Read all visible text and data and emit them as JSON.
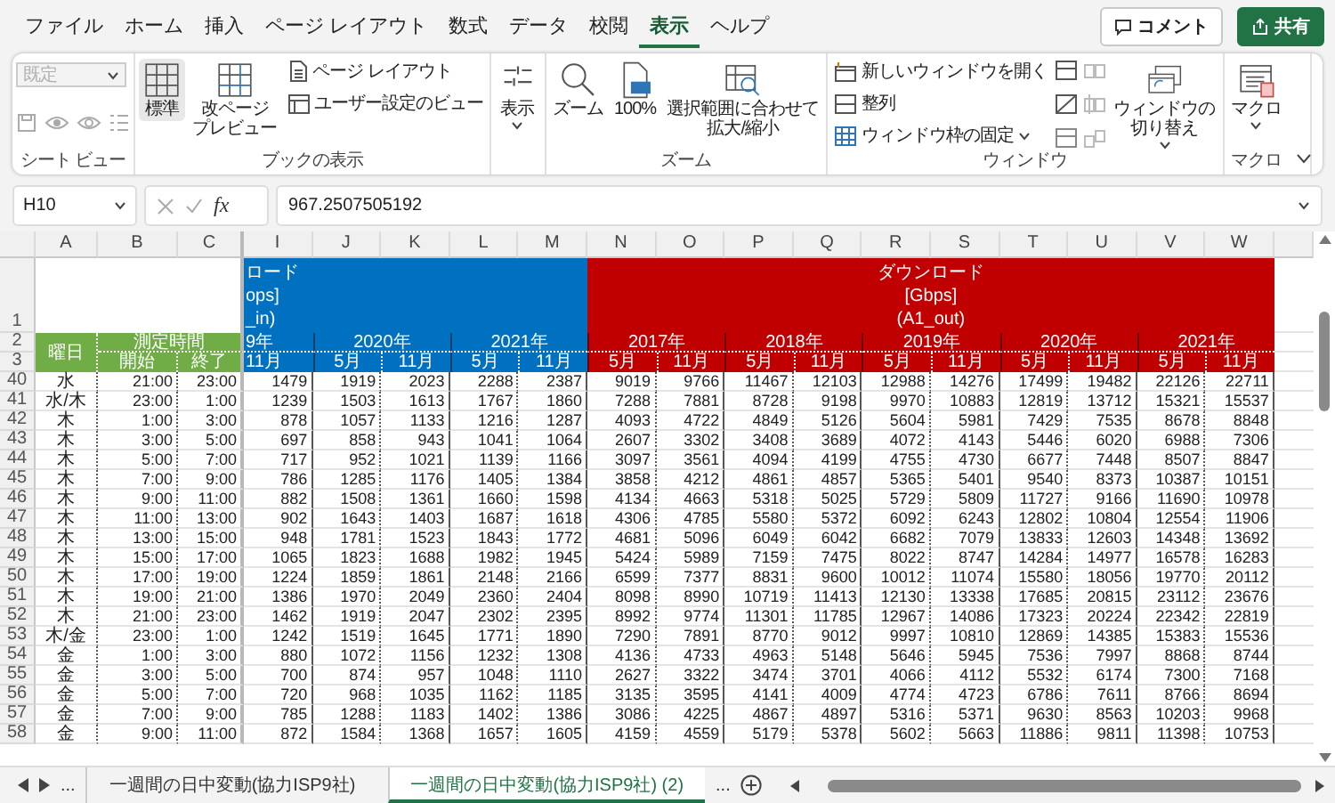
{
  "menu_tabs": [
    {
      "label": "ファイル",
      "selected": false
    },
    {
      "label": "ホーム",
      "selected": false
    },
    {
      "label": "挿入",
      "selected": false
    },
    {
      "label": "ページ レイアウト",
      "selected": false
    },
    {
      "label": "数式",
      "selected": false
    },
    {
      "label": "データ",
      "selected": false
    },
    {
      "label": "校閲",
      "selected": false
    },
    {
      "label": "表示",
      "selected": true
    },
    {
      "label": "ヘルプ",
      "selected": false
    }
  ],
  "top_buttons": [
    {
      "kind": "comment",
      "label": "コメント"
    },
    {
      "kind": "share",
      "label": "共有"
    }
  ],
  "ribbon": [
    {
      "label": "シート ビュー",
      "items": [
        {
          "kind": "dropdown",
          "label": "既定",
          "disabled": true
        }
      ]
    },
    {
      "label": "ブックの表示",
      "items": [
        {
          "kind": "large",
          "label": "標準",
          "selected": true
        },
        {
          "kind": "large",
          "lines": [
            "改ページ",
            "プレビュー"
          ],
          "selected": false
        },
        {
          "kind": "small",
          "label": "ページ レイアウト"
        },
        {
          "kind": "small",
          "label": "ユーザー設定のビュー"
        }
      ]
    },
    {
      "items": [
        {
          "kind": "large",
          "label": "表示",
          "dropdown": true
        }
      ]
    },
    {
      "label": "ズーム",
      "items": [
        {
          "kind": "large",
          "label": "ズーム"
        },
        {
          "kind": "large",
          "label": "100%"
        },
        {
          "kind": "large",
          "lines": [
            "選択範囲に合わせて",
            "拡大/縮小"
          ]
        }
      ]
    },
    {
      "label": "ウィンドウ",
      "items": [
        {
          "kind": "small",
          "label": "新しいウィンドウを開く"
        },
        {
          "kind": "small",
          "label": "整列"
        },
        {
          "kind": "small",
          "label": "ウィンドウ枠の固定",
          "dropdown": true
        },
        {
          "kind": "large",
          "lines": [
            "ウィンドウの",
            "切り替え"
          ],
          "dropdown": true
        }
      ]
    },
    {
      "label": "マクロ",
      "items": [
        {
          "kind": "large",
          "label": "マクロ",
          "dropdown": true
        }
      ]
    }
  ],
  "formula_bar": {
    "name_box": "H10",
    "function_label": "fx",
    "value": "967.2507505192"
  },
  "sheet": {
    "columns": [
      "A",
      "B",
      "C",
      "I",
      "J",
      "K",
      "L",
      "M",
      "N",
      "O",
      "P",
      "Q",
      "R",
      "S",
      "T",
      "U",
      "V",
      "W"
    ],
    "header_row_numbers": [
      "1",
      "2",
      "3"
    ],
    "upload_title_lines": [
      "ロード",
      "ops]",
      "_in)"
    ],
    "download_title_lines": [
      "ダウンロード",
      "[Gbps]",
      "(A1_out)"
    ],
    "day_label": "曜日",
    "time_label": "測定時間",
    "start_label": "開始",
    "end_label": "終了",
    "upload_years": [
      {
        "label": "9年",
        "months": [
          "11月"
        ]
      },
      {
        "label": "2020年",
        "months": [
          "5月",
          "11月"
        ]
      },
      {
        "label": "2021年",
        "months": [
          "5月",
          "11月"
        ]
      }
    ],
    "download_years": [
      {
        "label": "2017年",
        "months": [
          "5月",
          "11月"
        ]
      },
      {
        "label": "2018年",
        "months": [
          "5月",
          "11月"
        ]
      },
      {
        "label": "2019年",
        "months": [
          "5月",
          "11月"
        ]
      },
      {
        "label": "2020年",
        "months": [
          "5月",
          "11月"
        ]
      },
      {
        "label": "2021年",
        "months": [
          "5月",
          "11月"
        ]
      }
    ],
    "rows": [
      {
        "row": "40",
        "day": "水",
        "start": "21:00",
        "end": "23:00",
        "values": [
          "1479",
          "1919",
          "2023",
          "2288",
          "2387",
          "9019",
          "9766",
          "11467",
          "12103",
          "12988",
          "14276",
          "17499",
          "19482",
          "22126",
          "22711"
        ]
      },
      {
        "row": "41",
        "day": "水/木",
        "start": "23:00",
        "end": "1:00",
        "values": [
          "1239",
          "1503",
          "1613",
          "1767",
          "1860",
          "7288",
          "7881",
          "8728",
          "9198",
          "9970",
          "10883",
          "12819",
          "13712",
          "15321",
          "15537"
        ]
      },
      {
        "row": "42",
        "day": "木",
        "start": "1:00",
        "end": "3:00",
        "values": [
          "878",
          "1057",
          "1133",
          "1216",
          "1287",
          "4093",
          "4722",
          "4849",
          "5126",
          "5604",
          "5981",
          "7429",
          "7535",
          "8678",
          "8848"
        ]
      },
      {
        "row": "43",
        "day": "木",
        "start": "3:00",
        "end": "5:00",
        "values": [
          "697",
          "858",
          "943",
          "1041",
          "1064",
          "2607",
          "3302",
          "3408",
          "3689",
          "4072",
          "4143",
          "5446",
          "6020",
          "6988",
          "7306"
        ]
      },
      {
        "row": "44",
        "day": "木",
        "start": "5:00",
        "end": "7:00",
        "values": [
          "717",
          "952",
          "1021",
          "1139",
          "1166",
          "3097",
          "3561",
          "4094",
          "4199",
          "4755",
          "4730",
          "6677",
          "7448",
          "8507",
          "8847"
        ]
      },
      {
        "row": "45",
        "day": "木",
        "start": "7:00",
        "end": "9:00",
        "values": [
          "786",
          "1285",
          "1176",
          "1405",
          "1384",
          "3858",
          "4212",
          "4861",
          "4857",
          "5365",
          "5401",
          "9540",
          "8373",
          "10387",
          "10151"
        ]
      },
      {
        "row": "46",
        "day": "木",
        "start": "9:00",
        "end": "11:00",
        "values": [
          "882",
          "1508",
          "1361",
          "1660",
          "1598",
          "4134",
          "4663",
          "5318",
          "5025",
          "5729",
          "5809",
          "11727",
          "9166",
          "11690",
          "10978"
        ]
      },
      {
        "row": "47",
        "day": "木",
        "start": "11:00",
        "end": "13:00",
        "values": [
          "902",
          "1643",
          "1403",
          "1687",
          "1618",
          "4306",
          "4785",
          "5580",
          "5372",
          "6092",
          "6243",
          "12802",
          "10804",
          "12554",
          "11906"
        ]
      },
      {
        "row": "48",
        "day": "木",
        "start": "13:00",
        "end": "15:00",
        "values": [
          "948",
          "1781",
          "1523",
          "1843",
          "1772",
          "4681",
          "5096",
          "6049",
          "6042",
          "6682",
          "7079",
          "13833",
          "12603",
          "14348",
          "13692"
        ]
      },
      {
        "row": "49",
        "day": "木",
        "start": "15:00",
        "end": "17:00",
        "values": [
          "1065",
          "1823",
          "1688",
          "1982",
          "1945",
          "5424",
          "5989",
          "7159",
          "7475",
          "8022",
          "8747",
          "14284",
          "14977",
          "16578",
          "16283"
        ]
      },
      {
        "row": "50",
        "day": "木",
        "start": "17:00",
        "end": "19:00",
        "values": [
          "1224",
          "1859",
          "1861",
          "2148",
          "2166",
          "6599",
          "7377",
          "8831",
          "9600",
          "10012",
          "11074",
          "15580",
          "18056",
          "19770",
          "20112"
        ]
      },
      {
        "row": "51",
        "day": "木",
        "start": "19:00",
        "end": "21:00",
        "values": [
          "1386",
          "1970",
          "2049",
          "2360",
          "2404",
          "8098",
          "8990",
          "10719",
          "11413",
          "12130",
          "13338",
          "17685",
          "20815",
          "23112",
          "23676"
        ]
      },
      {
        "row": "52",
        "day": "木",
        "start": "21:00",
        "end": "23:00",
        "values": [
          "1462",
          "1919",
          "2047",
          "2302",
          "2395",
          "8992",
          "9774",
          "11301",
          "11785",
          "12967",
          "14086",
          "17323",
          "20224",
          "22342",
          "22819"
        ]
      },
      {
        "row": "53",
        "day": "木/金",
        "start": "23:00",
        "end": "1:00",
        "values": [
          "1242",
          "1519",
          "1645",
          "1771",
          "1890",
          "7290",
          "7891",
          "8770",
          "9012",
          "9997",
          "10810",
          "12869",
          "14385",
          "15383",
          "15536"
        ]
      },
      {
        "row": "54",
        "day": "金",
        "start": "1:00",
        "end": "3:00",
        "values": [
          "880",
          "1072",
          "1156",
          "1232",
          "1308",
          "4136",
          "4733",
          "4963",
          "5148",
          "5646",
          "5945",
          "7536",
          "7997",
          "8868",
          "8744"
        ]
      },
      {
        "row": "55",
        "day": "金",
        "start": "3:00",
        "end": "5:00",
        "values": [
          "700",
          "874",
          "957",
          "1048",
          "1110",
          "2627",
          "3322",
          "3474",
          "3701",
          "4066",
          "4112",
          "5532",
          "6174",
          "7300",
          "7168"
        ]
      },
      {
        "row": "56",
        "day": "金",
        "start": "5:00",
        "end": "7:00",
        "values": [
          "720",
          "968",
          "1035",
          "1162",
          "1185",
          "3135",
          "3595",
          "4141",
          "4009",
          "4774",
          "4723",
          "6786",
          "7611",
          "8766",
          "8694"
        ]
      },
      {
        "row": "57",
        "day": "金",
        "start": "7:00",
        "end": "9:00",
        "values": [
          "785",
          "1288",
          "1183",
          "1402",
          "1386",
          "3086",
          "4225",
          "4867",
          "4897",
          "5316",
          "5371",
          "9630",
          "8563",
          "10203",
          "9968"
        ]
      },
      {
        "row": "58",
        "day": "金",
        "start": "9:00",
        "end": "11:00",
        "values": [
          "872",
          "1584",
          "1368",
          "1657",
          "1605",
          "4159",
          "4559",
          "5179",
          "5378",
          "5602",
          "5663",
          "11886",
          "9811",
          "11398",
          "10753"
        ]
      }
    ]
  },
  "sheet_tabs": {
    "overflow_left": "...",
    "overflow_right": "...",
    "tabs": [
      {
        "label": "一週間の日中変動(協力ISP9社)",
        "selected": false
      },
      {
        "label": "一週間の日中変動(協力ISP9社) (2)",
        "selected": true
      }
    ]
  }
}
